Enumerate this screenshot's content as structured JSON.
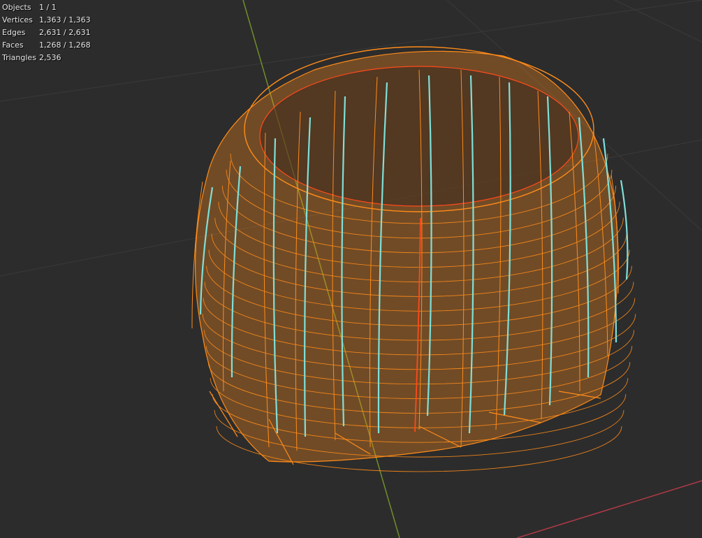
{
  "viewport": {
    "background": "#2c2c2c",
    "mesh_select_color": "#ff8c1a",
    "active_edge_color": "#ff4a1a",
    "seam_color": "#7fe0d8",
    "axis_y_color": "#6f8f2a",
    "axis_x_color": "#b03a48",
    "grid_color": "#3a3a3a"
  },
  "stats": [
    {
      "label": "Objects",
      "value": "1 / 1"
    },
    {
      "label": "Vertices",
      "value": "1,363 / 1,363"
    },
    {
      "label": "Edges",
      "value": "2,631 / 2,631"
    },
    {
      "label": "Faces",
      "value": "1,268 / 1,268"
    },
    {
      "label": "Triangles",
      "value": "2,536"
    }
  ]
}
